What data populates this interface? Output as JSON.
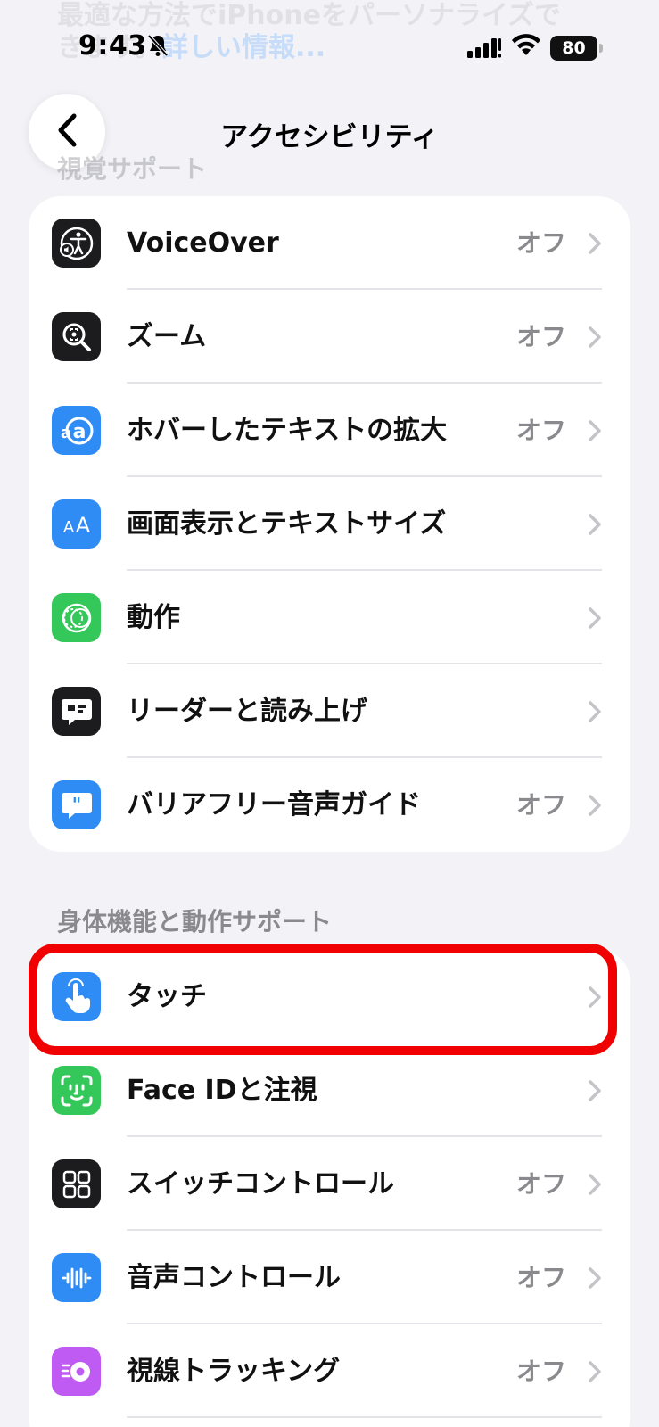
{
  "status_bar": {
    "ghost_line1": "最適な方法でiPhoneをパーソナライズで",
    "ghost_line2_a": "きます。",
    "ghost_line2_link": "詳しい情報...",
    "time": "9:43",
    "battery": "80"
  },
  "nav": {
    "title": "アクセシビリティ"
  },
  "sections": {
    "vision_header": "視覚サポート",
    "physical_header": "身体機能と動作サポート"
  },
  "vision_items": [
    {
      "label": "VoiceOver",
      "value": "オフ",
      "icon": "voiceover-icon",
      "color": "#1c1c1e"
    },
    {
      "label": "ズーム",
      "value": "オフ",
      "icon": "zoom-icon",
      "color": "#1c1c1e"
    },
    {
      "label": "ホバーしたテキストの拡大",
      "value": "オフ",
      "icon": "hover-text-icon",
      "color": "#2f8cf5"
    },
    {
      "label": "画面表示とテキストサイズ",
      "value": "",
      "icon": "text-size-icon",
      "color": "#2f8cf5"
    },
    {
      "label": "動作",
      "value": "",
      "icon": "motion-icon",
      "color": "#34c759"
    },
    {
      "label": "リーダーと読み上げ",
      "value": "",
      "icon": "speech-icon",
      "color": "#1c1c1e"
    },
    {
      "label": "バリアフリー音声ガイド",
      "value": "オフ",
      "icon": "audio-description-icon",
      "color": "#2f8cf5"
    }
  ],
  "physical_items": [
    {
      "label": "タッチ",
      "value": "",
      "icon": "touch-icon",
      "color": "#2f8cf5"
    },
    {
      "label": "Face IDと注視",
      "value": "",
      "icon": "face-id-icon",
      "color": "#34c759"
    },
    {
      "label": "スイッチコントロール",
      "value": "オフ",
      "icon": "switch-control-icon",
      "color": "#1c1c1e"
    },
    {
      "label": "音声コントロール",
      "value": "オフ",
      "icon": "voice-control-icon",
      "color": "#2f8cf5"
    },
    {
      "label": "視線トラッキング",
      "value": "オフ",
      "icon": "eye-tracking-icon",
      "color": "#bf5af2"
    }
  ],
  "highlight_color": "#f00000"
}
